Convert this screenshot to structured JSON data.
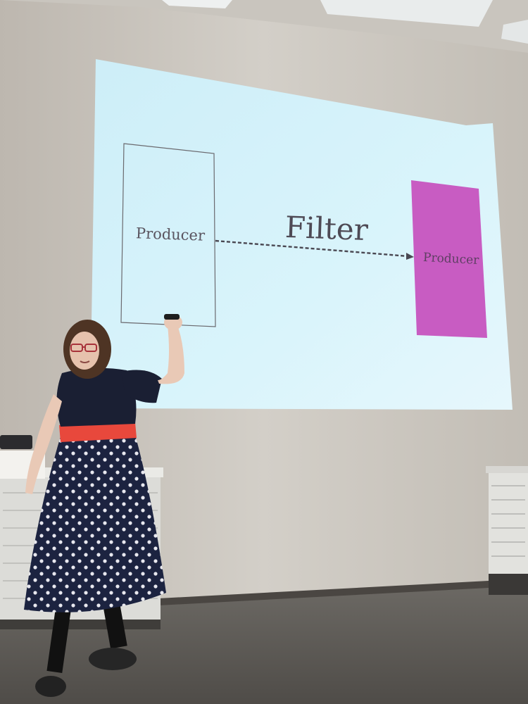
{
  "slide": {
    "left_box_label": "Producer",
    "right_box_label": "Producer",
    "arrow_label": "Filter"
  },
  "colors": {
    "screen": "#d6f3fb",
    "wall": "#cbc6bf",
    "floor": "#5f5c58",
    "right_box_fill": "#c85cc2",
    "dress_sash": "#e8483c",
    "dress_skirt": "#1e2540"
  }
}
